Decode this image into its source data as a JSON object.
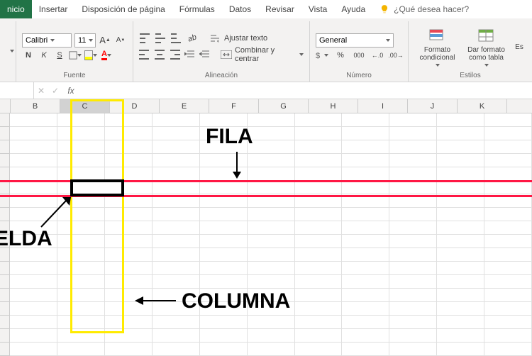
{
  "tabs": {
    "inicio": "nicio",
    "insertar": "Insertar",
    "disposicion": "Disposición de página",
    "formulas": "Fórmulas",
    "datos": "Datos",
    "revisar": "Revisar",
    "vista": "Vista",
    "ayuda": "Ayuda",
    "tellme": "¿Qué desea hacer?"
  },
  "font": {
    "name": "Calibri",
    "size": "11",
    "group_label": "Fuente",
    "bold": "N",
    "italic": "K",
    "strike": "S",
    "increase": "A",
    "decrease": "A",
    "fill_color": "#ffff00",
    "font_color": "#ff0000"
  },
  "alignment": {
    "wrap": "Ajustar texto",
    "merge": "Combinar y centrar",
    "group_label": "Alineación"
  },
  "number": {
    "format": "General",
    "group_label": "Número"
  },
  "styles": {
    "conditional": "Formato condicional",
    "as_table": "Dar formato como tabla",
    "cell_styles": "Es",
    "group_label": "Estilos"
  },
  "formula_bar": {
    "namebox": "",
    "fx": "fx",
    "value": ""
  },
  "columns": [
    "B",
    "C",
    "D",
    "E",
    "F",
    "G",
    "H",
    "I",
    "J",
    "K"
  ],
  "annotations": {
    "fila": "FILA",
    "celda": "ELDA",
    "columna": "COLUMNA"
  }
}
